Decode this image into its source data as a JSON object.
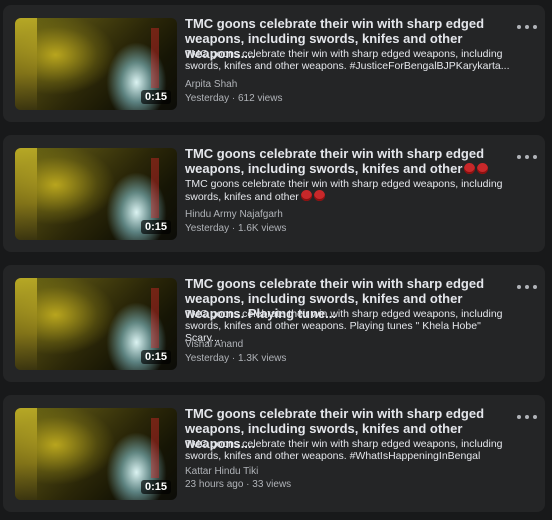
{
  "videos": [
    {
      "title": "TMC goons celebrate their win with sharp edged weapons, including swords, knifes and other weapons....",
      "description": "TMC goons celebrate their win with sharp edged weapons, including swords, knifes and other weapons. #JusticeForBengalBJPKarykarta...",
      "author": "Arpita Shah",
      "meta": "Yesterday · 612 views",
      "duration": "0:15"
    },
    {
      "title": "TMC goons celebrate their win with sharp edged weapons, including swords, knifes and other",
      "description": "TMC goons celebrate their win with sharp edged weapons, including swords, knifes and other",
      "author": "Hindu Army Najafgarh",
      "meta": "Yesterday · 1.6K views",
      "duration": "0:15"
    },
    {
      "title": "TMC goons celebrate their win with sharp edged weapons, including swords, knifes and other weapons. Playing tune...",
      "description": "TMC goons celebrate their win with sharp edged weapons, including swords, knifes and other weapons. Playing tunes \" Khela Hobe\" Scary....",
      "author": "Vishal Anand",
      "meta": "Yesterday · 1.3K views",
      "duration": "0:15"
    },
    {
      "title": "TMC goons celebrate their win with sharp edged weapons, including swords, knifes and other weapons....",
      "description": "TMC goons celebrate their win with sharp edged weapons, including swords, knifes and other weapons. #WhatIsHappeningInBengal",
      "author": "Kattar Hindu Tiki",
      "meta": "23 hours ago · 33 views",
      "duration": "0:15"
    }
  ],
  "icons": {
    "more": "more-options-icon",
    "emoji": "angry-face-emoji-icon"
  },
  "colors": {
    "background": "#18191a",
    "card": "#242526",
    "primary_text": "#e4e6eb",
    "secondary_text": "#b0b3b8"
  }
}
